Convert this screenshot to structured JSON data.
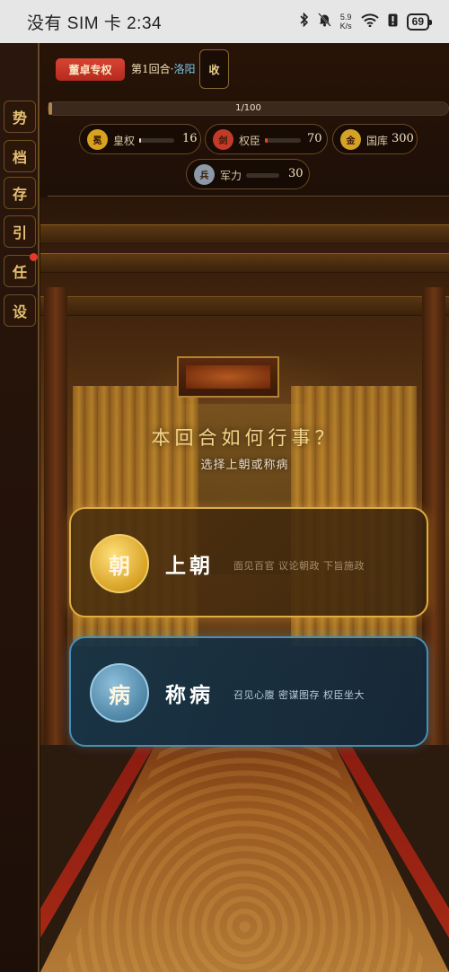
{
  "status_bar": {
    "carrier_time": "没有 SIM 卡 2:34",
    "net_speed_value": "5.9",
    "net_speed_unit": "K/s",
    "battery": "69"
  },
  "side_rail": {
    "menu_icon": "☰",
    "items": [
      {
        "label": "势",
        "badge": false
      },
      {
        "label": "档",
        "badge": false
      },
      {
        "label": "存",
        "badge": false
      },
      {
        "label": "引",
        "badge": false
      },
      {
        "label": "任",
        "badge": true
      },
      {
        "label": "设",
        "badge": false
      }
    ]
  },
  "header": {
    "mode_badge": "董卓专权",
    "round_prefix": "第1回合·",
    "city": "洛阳",
    "collapse_label": "收",
    "progress": {
      "text": "1/100",
      "current": 1,
      "total": 100
    },
    "stats": [
      {
        "icon_glyph": "冕",
        "label": "皇权",
        "value": "16",
        "fill": 0.02,
        "color": "#d8a21f",
        "bar_color": "#e8e0d0"
      },
      {
        "icon_glyph": "剑",
        "label": "权臣",
        "value": "70",
        "fill": 0.08,
        "color": "#c23a28",
        "bar_color": "#e0452f"
      },
      {
        "icon_glyph": "金",
        "label": "国库",
        "value": "300",
        "color": "#d4a326"
      },
      {
        "icon_glyph": "兵",
        "label": "军力",
        "value": "30",
        "fill": 0.0,
        "color": "#8c99a8",
        "bar_color": "#b0b8c4"
      }
    ]
  },
  "scene": {
    "prompt_title": "本回合如何行事？",
    "prompt_sub": "选择上朝或称病",
    "options": [
      {
        "emblem": "朝",
        "title": "上朝",
        "desc": "面见百官 议论朝政 下旨施政"
      },
      {
        "emblem": "病",
        "title": "称病",
        "desc": "召见心腹 密谋图存 权臣坐大"
      }
    ]
  }
}
